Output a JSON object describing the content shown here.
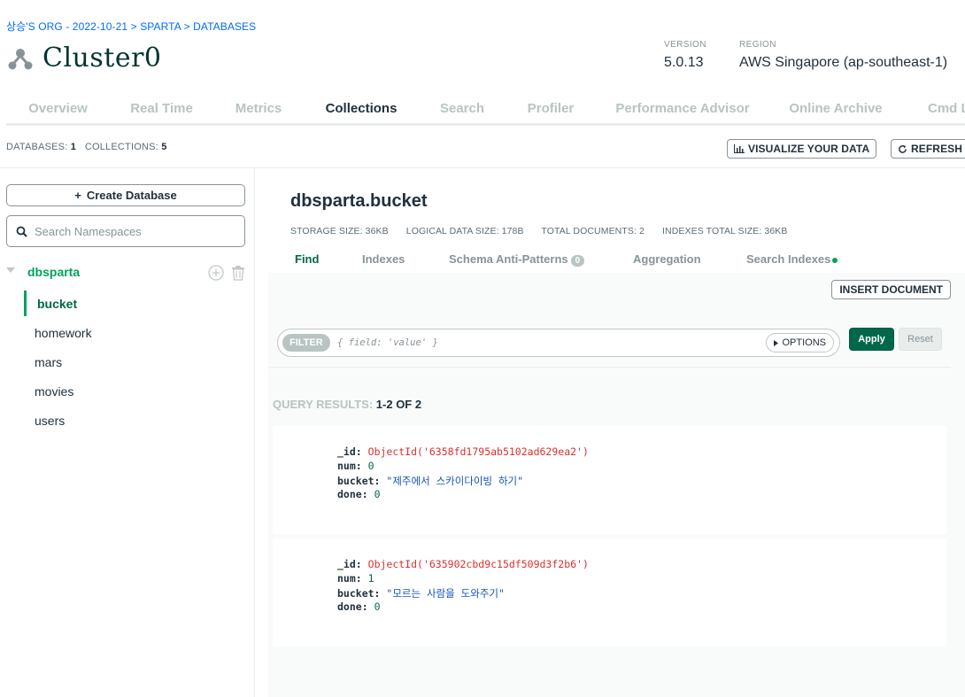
{
  "breadcrumb": {
    "org": "상승'S ORG - 2022-10-21",
    "project": "SPARTA",
    "section": "DATABASES"
  },
  "cluster": {
    "name": "Cluster0",
    "version_label": "VERSION",
    "version": "5.0.13",
    "region_label": "REGION",
    "region": "AWS Singapore (ap-southeast-1)"
  },
  "tabs": [
    {
      "label": "Overview"
    },
    {
      "label": "Real Time"
    },
    {
      "label": "Metrics"
    },
    {
      "label": "Collections"
    },
    {
      "label": "Search"
    },
    {
      "label": "Profiler"
    },
    {
      "label": "Performance Advisor"
    },
    {
      "label": "Online Archive"
    },
    {
      "label": "Cmd L"
    }
  ],
  "stats": {
    "databases_label": "DATABASES:",
    "databases_count": "1",
    "collections_label": "COLLECTIONS:",
    "collections_count": "5"
  },
  "toolbar": {
    "visualize_label": "VISUALIZE YOUR DATA",
    "refresh_label": "REFRESH"
  },
  "sidebar": {
    "create_db_label": "Create Database",
    "search_placeholder": "Search Namespaces",
    "database": "dbsparta",
    "collections": [
      "bucket",
      "homework",
      "mars",
      "movies",
      "users"
    ]
  },
  "namespace": {
    "title": "dbsparta.bucket",
    "storage_size": "STORAGE SIZE: 36KB",
    "logical_size": "LOGICAL DATA SIZE: 178B",
    "total_docs": "TOTAL DOCUMENTS: 2",
    "indexes_size": "INDEXES TOTAL SIZE: 36KB"
  },
  "subtabs": {
    "find": "Find",
    "indexes": "Indexes",
    "schema": "Schema Anti-Patterns",
    "schema_count": "0",
    "aggregation": "Aggregation",
    "search_indexes": "Search Indexes"
  },
  "query": {
    "insert_label": "INSERT DOCUMENT",
    "filter_label": "FILTER",
    "filter_placeholder": "{ field: 'value' }",
    "options_label": "OPTIONS",
    "apply_label": "Apply",
    "reset_label": "Reset",
    "results_label": "QUERY RESULTS:",
    "results_range": "1-2 OF 2"
  },
  "documents": [
    {
      "id_key": "_id:",
      "id": "ObjectId('6358fd1795ab5102ad629ea2')",
      "num_key": "num:",
      "num": "0",
      "bucket_key": "bucket:",
      "bucket": "\"제주에서 스카이다이빙 하기\"",
      "done_key": "done:",
      "done": "0"
    },
    {
      "id_key": "_id:",
      "id": "ObjectId('635902cbd9c15df509d3f2b6')",
      "num_key": "num:",
      "num": "1",
      "bucket_key": "bucket:",
      "bucket": "\"모르는 사람을 도와주기\"",
      "done_key": "done:",
      "done": "0"
    }
  ]
}
